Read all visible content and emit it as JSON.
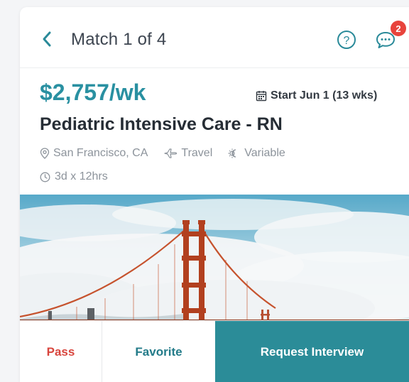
{
  "header": {
    "title": "Match 1 of 4",
    "back_icon": "chevron-left-icon",
    "help_icon": "question-circle-icon",
    "chat_icon": "chat-bubble-icon",
    "chat_badge": "2"
  },
  "job": {
    "rate": "$2,757/wk",
    "start": "Start Jun 1 (13 wks)",
    "title": "Pediatric Intensive Care - RN",
    "location": "San Francisco, CA",
    "type": "Travel",
    "schedule": "Variable",
    "shift": "3d x 12hrs"
  },
  "image": {
    "subject": "golden-gate-bridge-photo"
  },
  "actions": {
    "pass": "Pass",
    "favorite": "Favorite",
    "request": "Request Interview"
  },
  "colors": {
    "accent": "#2990a1",
    "primary_button": "#2b8c98",
    "pass": "#d8453d",
    "badge": "#e8433c"
  }
}
